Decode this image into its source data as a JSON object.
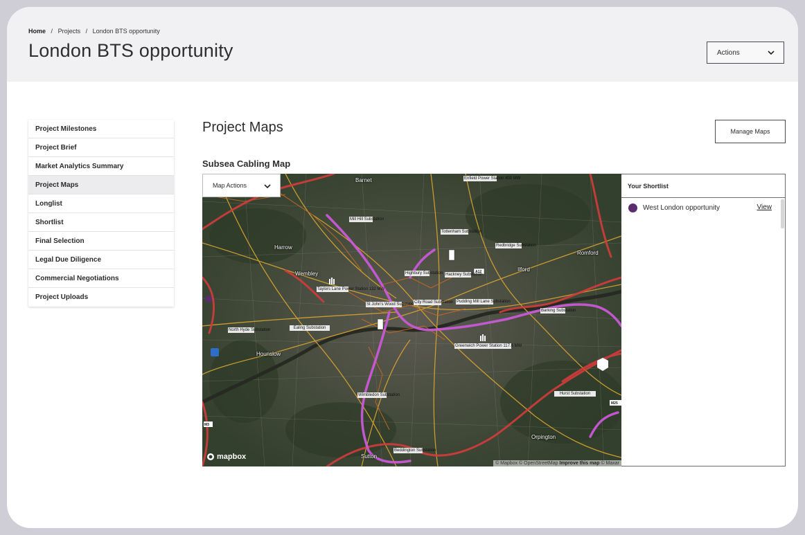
{
  "breadcrumb": [
    "Home",
    "Projects",
    "London BTS opportunity"
  ],
  "breadcrumb_sep": "/",
  "page_title": "London BTS opportunity",
  "actions_label": "Actions",
  "sidebar": {
    "items": [
      {
        "label": "Project Milestones"
      },
      {
        "label": "Project Brief"
      },
      {
        "label": "Market Analytics Summary"
      },
      {
        "label": "Project Maps",
        "active": true
      },
      {
        "label": "Longlist"
      },
      {
        "label": "Shortlist"
      },
      {
        "label": "Final Selection"
      },
      {
        "label": "Legal Due Diligence"
      },
      {
        "label": "Commercial Negotiations"
      },
      {
        "label": "Project Uploads"
      }
    ]
  },
  "main": {
    "section_title": "Project Maps",
    "manage_maps_label": "Manage Maps",
    "map_title": "Subsea Cabling Map"
  },
  "map": {
    "actions_label": "Map Actions",
    "place_labels": [
      "Barnet",
      "Harrow",
      "Wembley",
      "Hounslow",
      "Romford",
      "Ilford",
      "Orpington",
      "Sutton"
    ],
    "substations": [
      "Mill Hill Substation",
      "Tottenham Substation",
      "Redbridge Substation",
      "Highbury Substation",
      "Hackney Substation",
      "Taylors Lane Power Station 132 MW",
      "St John's Wood Substation",
      "City Road Substation",
      "Pudding Mill Lane Substation",
      "Barking Substation",
      "North Hyde Substation",
      "Ealing Substation",
      "Greenwich Power Station 117.6 MW",
      "Wimbledon Substation",
      "Hurst Substation",
      "Beddington Substation",
      "Enfield Power Station 400 MW"
    ],
    "road_shields": [
      "A12",
      "A1",
      "M25",
      "M3",
      "A3"
    ],
    "logo": "mapbox",
    "attribution": "© Mapbox © OpenStreetMap",
    "attribution_link": "Improve this map",
    "attribution_tail": "© Maxar",
    "colors": {
      "power_line": "#d23c3c",
      "cable": "#c95ad6",
      "road": "#d8a531"
    }
  },
  "shortlist": {
    "title": "Your Shortlist",
    "items": [
      {
        "name": "West London opportunity",
        "action": "View",
        "color": "#5b2d6e"
      }
    ]
  }
}
